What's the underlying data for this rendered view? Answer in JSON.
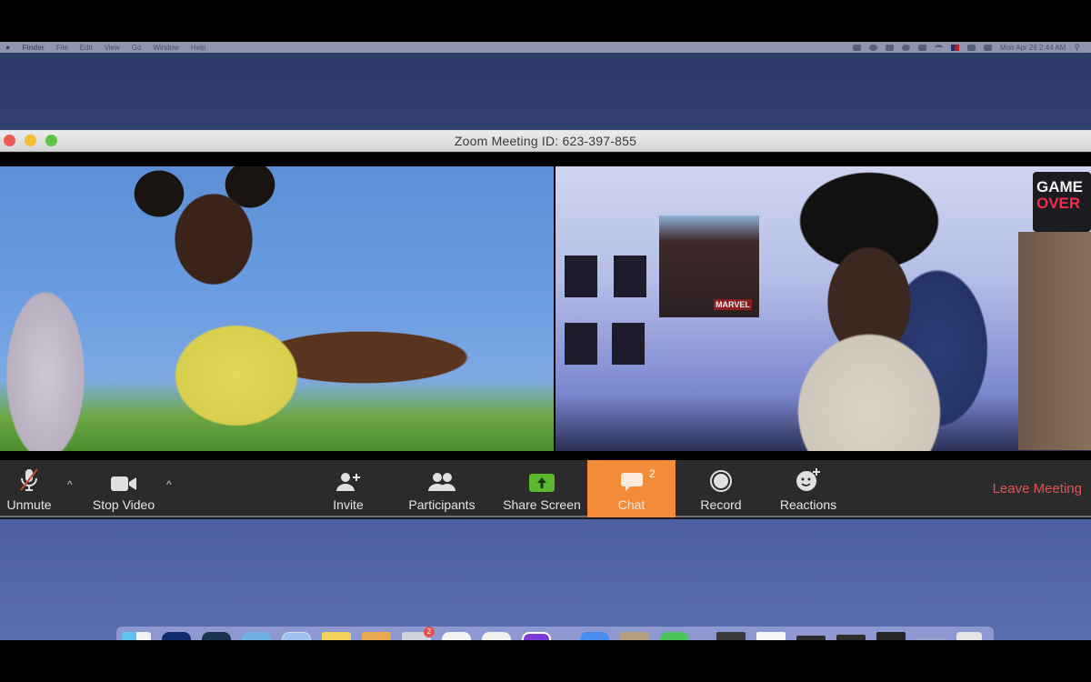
{
  "menubar": {
    "apple": "",
    "app_name": "Finder",
    "menus": [
      "File",
      "Edit",
      "View",
      "Go",
      "Window",
      "Help"
    ],
    "clock": "Mon Apr 26  2:44 AM"
  },
  "window": {
    "title": "Zoom Meeting ID: 623-397-855"
  },
  "video": {
    "left_tile": {
      "description": "participant video - woman lying in grass blowing a kiss"
    },
    "right_tile": {
      "description": "participant video - man with glasses in bedroom",
      "poster_label": "MARVEL",
      "sign_line1": "GAME",
      "sign_line2": "OVER"
    }
  },
  "toolbar": {
    "unmute_label": "Unmute",
    "stop_video_label": "Stop Video",
    "invite_label": "Invite",
    "participants_label": "Participants",
    "share_screen_label": "Share Screen",
    "chat_label": "Chat",
    "chat_badge": "2",
    "record_label": "Record",
    "reactions_label": "Reactions",
    "leave_label": "Leave Meeting",
    "caret": "^"
  },
  "colors": {
    "chat_active": "#f28c38",
    "leave": "#e2534f",
    "share_green": "#5cb82f",
    "toolbar_bg": "#2b2b2b"
  },
  "dock": {
    "icons": [
      "finder",
      "app-dark-blue",
      "app-dark-teal",
      "app-light-blue",
      "safari",
      "notes",
      "folder",
      "mail",
      "app-white",
      "app-white-2",
      "app-purple",
      "app-blue",
      "preview",
      "facetime",
      "app-dark",
      "app-white-doc",
      "app-dark-2",
      "app-dark-3",
      "app-dark-4",
      "app-gray",
      "trash"
    ],
    "badge": "2"
  }
}
